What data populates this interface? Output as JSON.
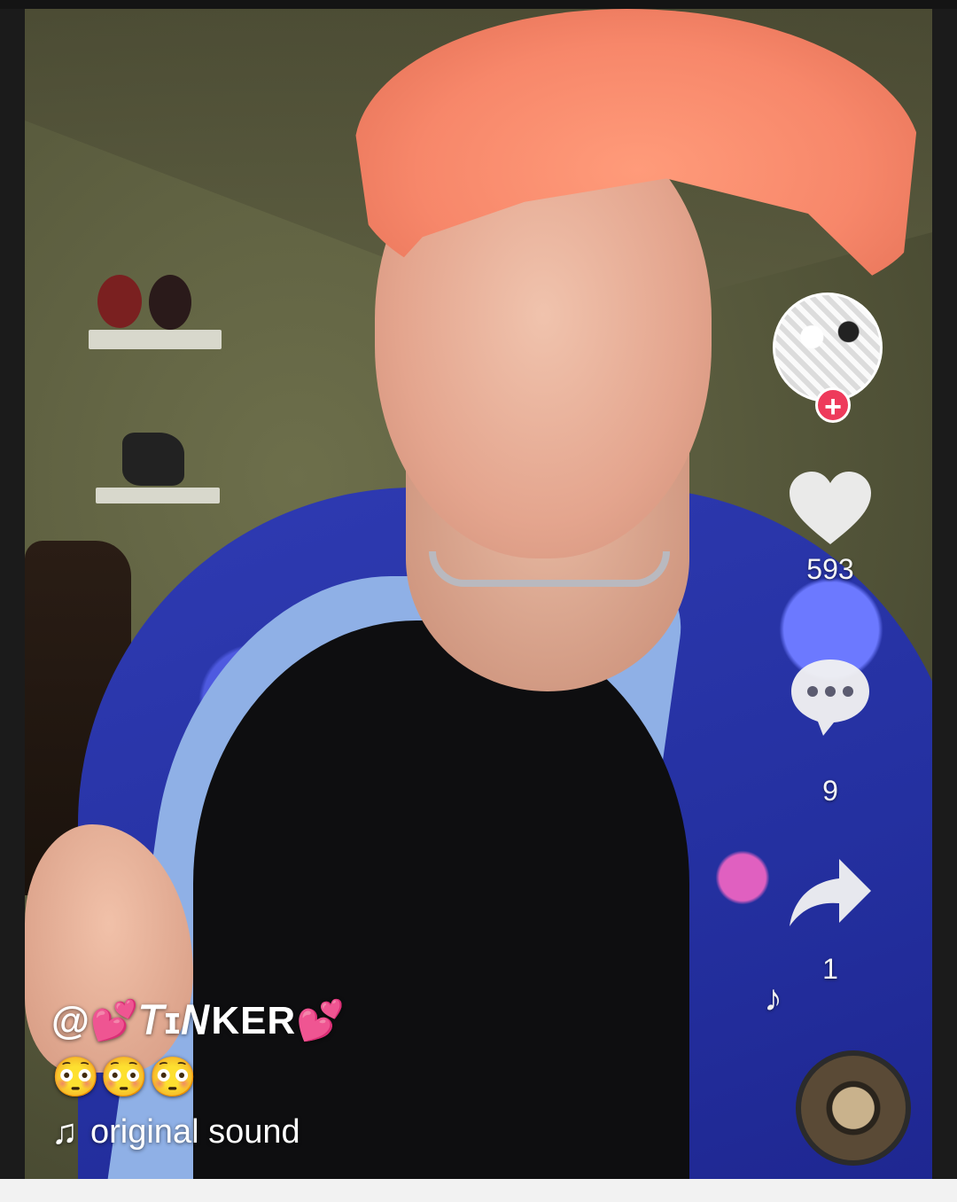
{
  "video": {
    "caption": {
      "username": "@💕𝘛ɪ𝘕KER💕",
      "description": "😳😳😳",
      "sound": "original sound"
    },
    "actions": {
      "likes": "593",
      "comments": "9",
      "shares": "1"
    },
    "follow_symbol": "+",
    "floating_note": "♪",
    "sound_note": "♫"
  },
  "colors": {
    "follow": "#ee3a5b",
    "icon": "#f2f2f2",
    "text": "#ffffff"
  },
  "icons": [
    "profile-avatar",
    "heart-icon",
    "comment-bubble-icon",
    "share-arrow-icon",
    "music-note-icon",
    "sound-disc"
  ]
}
